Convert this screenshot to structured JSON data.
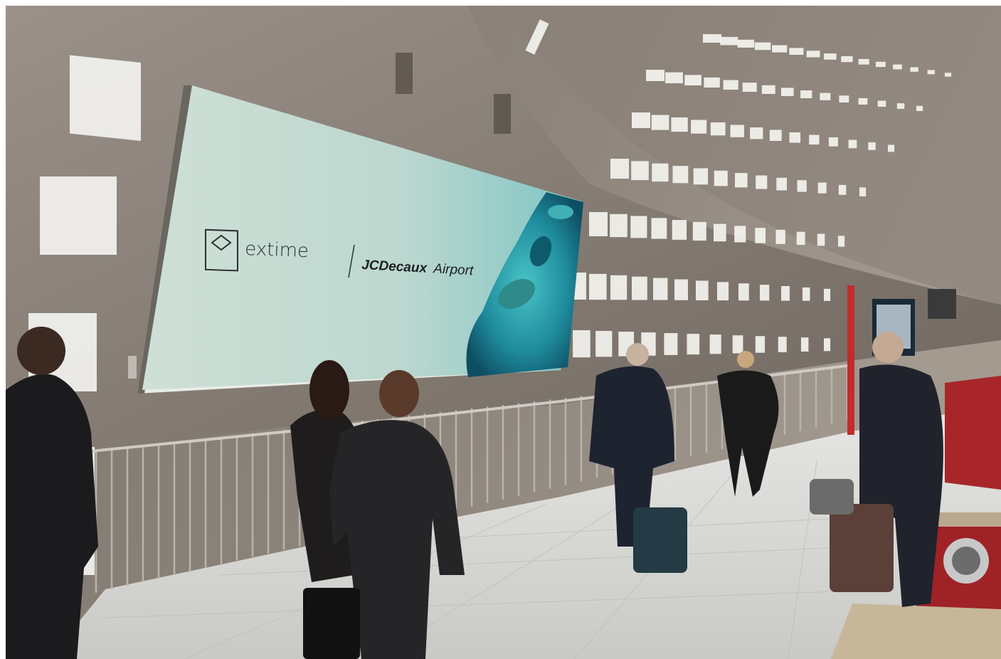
{
  "billboard": {
    "brand_name": "extime",
    "partner_bold": "JCDecaux",
    "partner_light": "Airport"
  },
  "colors": {
    "concrete": "#8a8178",
    "concrete_dark": "#5e5750",
    "billboard_bg": "#c9dcd3",
    "face_teal": "#2aa6b0",
    "floor": "#d8d8d6",
    "counter_red": "#a8262a"
  }
}
